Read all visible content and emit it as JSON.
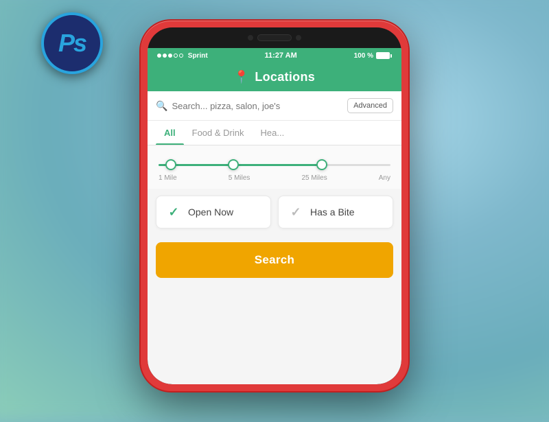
{
  "ps_badge": {
    "label": "Ps"
  },
  "status_bar": {
    "carrier": "Sprint",
    "time": "11:27 AM",
    "battery_pct": "100 %"
  },
  "header": {
    "title": "Locations"
  },
  "search": {
    "placeholder": "Search... pizza, salon, joe's",
    "advanced_label": "Advanced"
  },
  "tabs": [
    {
      "label": "All",
      "active": true
    },
    {
      "label": "Food & Drink",
      "active": false
    },
    {
      "label": "Hea...",
      "active": false
    }
  ],
  "slider": {
    "labels": [
      "1 Mile",
      "5 Miles",
      "25 Miles",
      "Any"
    ]
  },
  "filters": [
    {
      "label": "Open Now",
      "checked": true
    },
    {
      "label": "Has a Bite",
      "checked": true
    }
  ],
  "search_button": {
    "label": "Search"
  }
}
